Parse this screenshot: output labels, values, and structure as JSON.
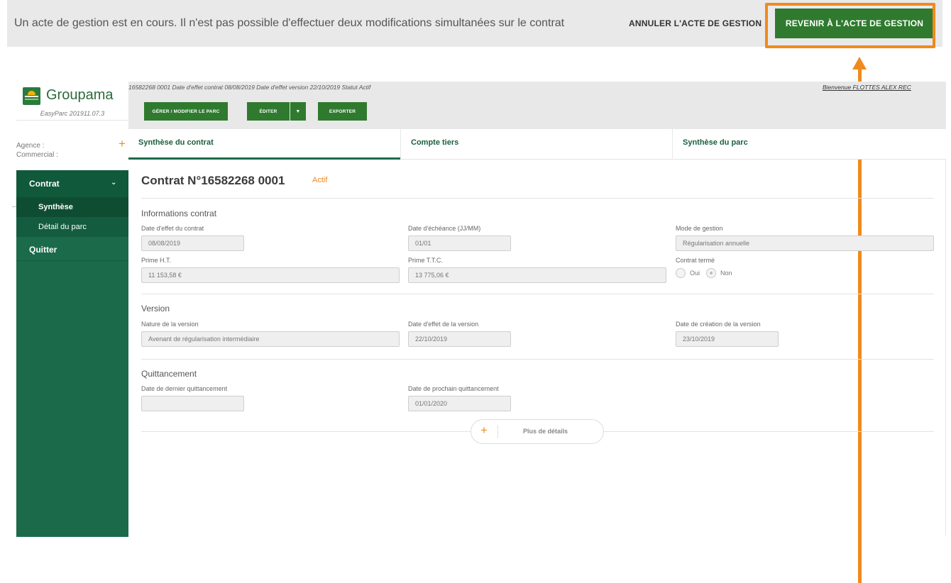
{
  "banner": {
    "message": "Un acte de gestion est en cours. Il n'est pas possible d'effectuer deux modifications simultanées sur le contrat",
    "cancel_label": "ANNULER L'ACTE DE GESTION",
    "back_label": "REVENIR À L'ACTE DE GESTION",
    "highlight_color": "#f08a1e"
  },
  "sidebar": {
    "brand": "Groupama",
    "version": "EasyParc 201911.07.3",
    "agence_label": "Agence :",
    "commercial_label": "Commercial :",
    "nav": {
      "contrat": "Contrat",
      "synthese": "Synthèse",
      "detail": "Détail du parc",
      "quitter": "Quitter"
    },
    "color": "#1b6b4b"
  },
  "header": {
    "meta": "16582268 0001   Date d'effet contrat 08/08/2019   Date d'effet version 22/10/2019   Statut Actif",
    "welcome": "Bienvenue FLOTTES ALEX REC",
    "buttons": {
      "gerer": "GÉRER / MODIFIER LE PARC",
      "editer": "ÉDITER",
      "exporter": "EXPORTER"
    }
  },
  "tabs": [
    "Synthèse du contrat",
    "Compte tiers",
    "Synthèse du parc"
  ],
  "contract": {
    "title": "Contrat N°16582268 0001",
    "status": "Actif"
  },
  "infos": {
    "title": "Informations contrat",
    "date_effet_label": "Date d'effet du contrat",
    "date_effet": "08/08/2019",
    "date_echeance_label": "Date d'échéance (JJ/MM)",
    "date_echeance": "01/01",
    "mode_gestion_label": "Mode de gestion",
    "mode_gestion": "Régularisation annuelle",
    "prime_ht_label": "Prime H.T.",
    "prime_ht": "11 153,58 €",
    "prime_ttc_label": "Prime T.T.C.",
    "prime_ttc": "13 775,06 €",
    "contrat_terme_label": "Contrat termé",
    "oui": "Oui",
    "non": "Non",
    "selected": "Non"
  },
  "version": {
    "title": "Version",
    "nature_label": "Nature de la version",
    "nature": "Avenant de régularisation intermédiaire",
    "date_effet_label": "Date d'effet de la version",
    "date_effet": "22/10/2019",
    "date_creation_label": "Date de création de la version",
    "date_creation": "23/10/2019"
  },
  "quittancement": {
    "title": "Quittancement",
    "dernier_label": "Date de dernier quittancement",
    "dernier": "",
    "prochain_label": "Date de prochain quittancement",
    "prochain": "01/01/2020"
  },
  "more_details": "Plus de détails"
}
